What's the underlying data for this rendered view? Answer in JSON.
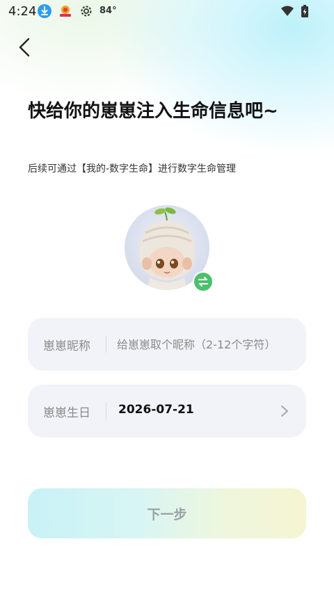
{
  "status_bar": {
    "time": "4:24",
    "temperature": "84°",
    "icons": [
      "download-icon",
      "app-notification-icon",
      "settings-gear-icon",
      "wifi-icon",
      "battery-charging-icon"
    ]
  },
  "header": {
    "back_icon": "chevron-left-icon"
  },
  "page": {
    "title": "快给你的崽崽注入生命信息吧~",
    "subtitle": "后续可通过【我的-数字生命】进行数字生命管理"
  },
  "avatar": {
    "swap_icon": "swap-arrows-icon",
    "badge_color": "#4cc06c"
  },
  "form": {
    "nickname": {
      "label": "崽崽昵称",
      "value": "",
      "placeholder": "给崽崽取个昵称（2-12个字符）"
    },
    "birthday": {
      "label": "崽崽生日",
      "value": "2026-07-21",
      "icon": "chevron-right-icon"
    }
  },
  "actions": {
    "next_label": "下一步"
  }
}
